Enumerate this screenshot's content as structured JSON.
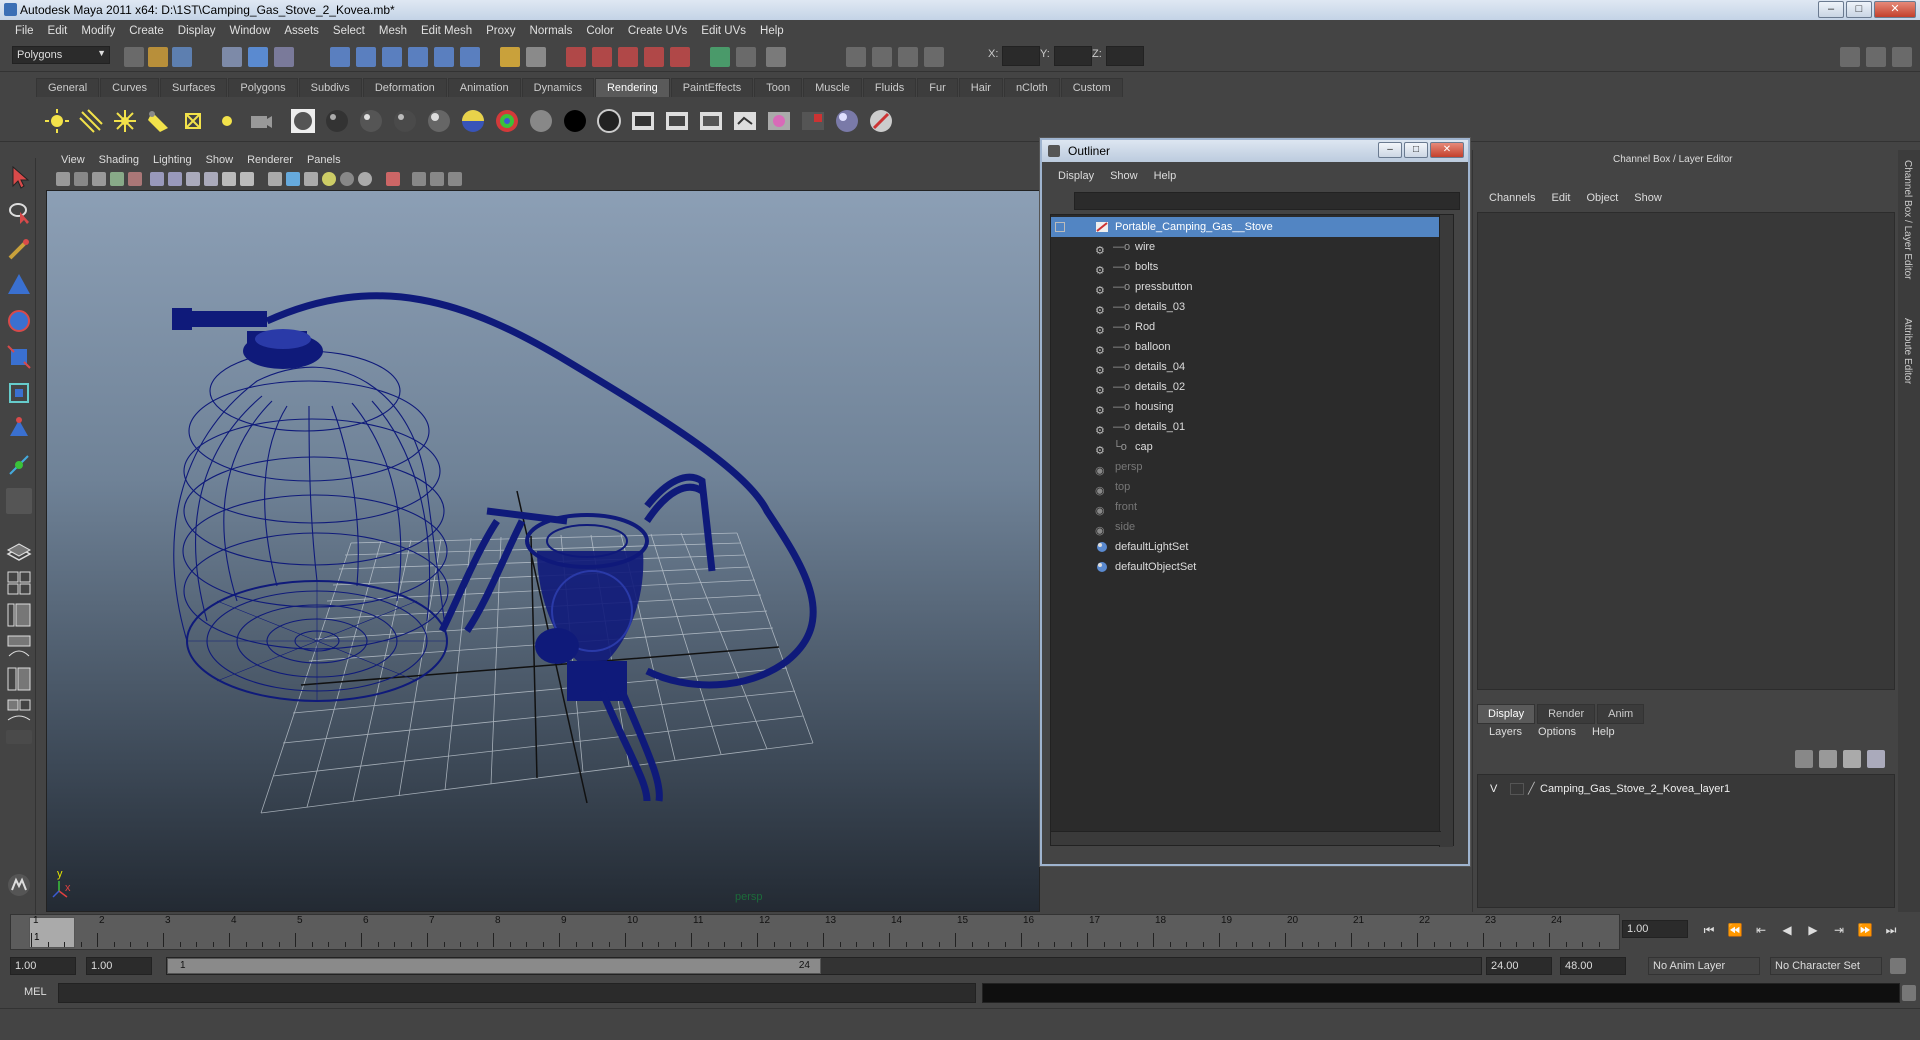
{
  "window": {
    "title": "Autodesk Maya 2011 x64: D:\\1ST\\Camping_Gas_Stove_2_Kovea.mb*"
  },
  "menubar": [
    "File",
    "Edit",
    "Modify",
    "Create",
    "Display",
    "Window",
    "Assets",
    "Select",
    "Mesh",
    "Edit Mesh",
    "Proxy",
    "Normals",
    "Color",
    "Create UVs",
    "Edit UVs",
    "Help"
  ],
  "statusline": {
    "mode": "Polygons",
    "x_label": "X:",
    "y_label": "Y:",
    "z_label": "Z:"
  },
  "shelf": {
    "tabs": [
      "General",
      "Curves",
      "Surfaces",
      "Polygons",
      "Subdivs",
      "Deformation",
      "Animation",
      "Dynamics",
      "Rendering",
      "PaintEffects",
      "Toon",
      "Muscle",
      "Fluids",
      "Fur",
      "Hair",
      "nCloth",
      "Custom"
    ],
    "active": "Rendering"
  },
  "viewport": {
    "menu": [
      "View",
      "Shading",
      "Lighting",
      "Show",
      "Renderer",
      "Panels"
    ],
    "camera_label": "persp",
    "axis_y": "y",
    "axis_x": "x",
    "colors": {
      "wire": "#0f1a7a",
      "grid": "#c8d0d8",
      "axis": "#111111"
    }
  },
  "outliner": {
    "title": "Outliner",
    "menu": [
      "Display",
      "Show",
      "Help"
    ],
    "root": "Portable_Camping_Gas__Stove",
    "children": [
      "wire",
      "bolts",
      "pressbutton",
      "details_03",
      "Rod",
      "balloon",
      "details_04",
      "details_02",
      "housing",
      "details_01",
      "cap"
    ],
    "cameras": [
      "persp",
      "top",
      "front",
      "side"
    ],
    "sets": [
      "defaultLightSet",
      "defaultObjectSet"
    ]
  },
  "channelbox": {
    "title": "Channel Box / Layer Editor",
    "menu": [
      "Channels",
      "Edit",
      "Object",
      "Show"
    ],
    "layer_tabs": [
      "Display",
      "Render",
      "Anim"
    ],
    "layer_tab_active": "Display",
    "layer_menu": [
      "Layers",
      "Options",
      "Help"
    ],
    "layer": {
      "visible": "V",
      "name": "Camping_Gas_Stove_2_Kovea_layer1"
    },
    "side_tabs": [
      "Channel Box / Layer Editor",
      "Attribute Editor"
    ]
  },
  "timeline": {
    "ticks": [
      "1",
      "2",
      "3",
      "4",
      "5",
      "6",
      "7",
      "8",
      "9",
      "10",
      "11",
      "12",
      "13",
      "14",
      "15",
      "16",
      "17",
      "18",
      "19",
      "20",
      "21",
      "22",
      "23",
      "24"
    ],
    "current_frame": "1",
    "current_time": "1.00"
  },
  "range": {
    "start": "1.00",
    "playback_start": "1.00",
    "slider_start": "1",
    "slider_end": "24",
    "playback_end": "24.00",
    "end": "48.00",
    "anim_layer": "No Anim Layer",
    "character_set": "No Character Set"
  },
  "cmdline": {
    "label": "MEL"
  }
}
